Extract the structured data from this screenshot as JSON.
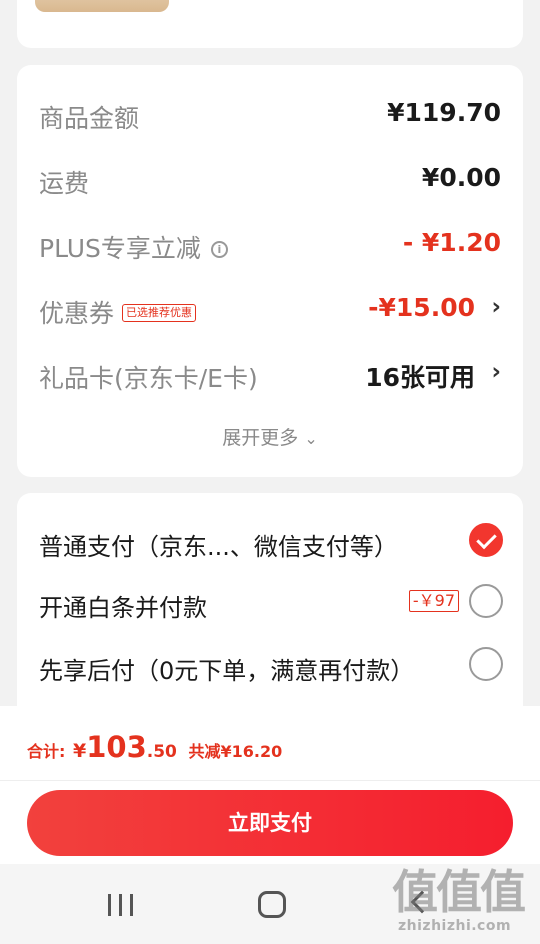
{
  "price_summary": {
    "goods_amount": {
      "label": "商品金额",
      "value": "¥119.70"
    },
    "shipping": {
      "label": "运费",
      "value": "¥0.00"
    },
    "plus_discount": {
      "label": "PLUS专享立减",
      "info_icon": "info-icon",
      "value": "- ¥1.20"
    },
    "coupon": {
      "label": "优惠券",
      "tag": "已选推荐优惠",
      "value": "-¥15.00"
    },
    "gift_card": {
      "label": "礼品卡(京东卡/E卡)",
      "value": "16张可用"
    },
    "expand_more": "展开更多"
  },
  "payment_methods": {
    "items": [
      {
        "label": "普通支付（京东...、微信支付等）",
        "selected": true
      },
      {
        "label": "开通白条并付款",
        "badge": "-￥97",
        "selected": false
      },
      {
        "label": "先享后付（0元下单，满意再付款）",
        "selected": false
      }
    ]
  },
  "checkout": {
    "total_label": "合计:",
    "currency": "¥",
    "total_integer": "103",
    "total_decimal": ".50",
    "total_reduction": "共减¥16.20",
    "pay_button": "立即支付"
  },
  "watermark": {
    "big": "值值值",
    "small": "zhizhizhi.com"
  },
  "colors": {
    "accent": "#e4321e",
    "button": "#f2362e",
    "background": "#f2f2f2"
  }
}
